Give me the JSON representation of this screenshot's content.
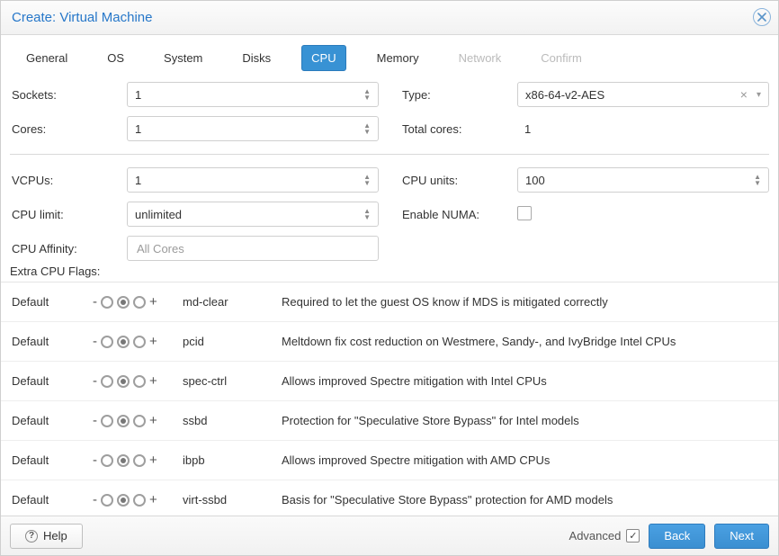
{
  "title": "Create: Virtual Machine",
  "tabs": [
    {
      "label": "General",
      "state": "normal"
    },
    {
      "label": "OS",
      "state": "normal"
    },
    {
      "label": "System",
      "state": "normal"
    },
    {
      "label": "Disks",
      "state": "normal"
    },
    {
      "label": "CPU",
      "state": "active"
    },
    {
      "label": "Memory",
      "state": "normal"
    },
    {
      "label": "Network",
      "state": "disabled"
    },
    {
      "label": "Confirm",
      "state": "disabled"
    }
  ],
  "form": {
    "sockets": {
      "label": "Sockets:",
      "value": "1"
    },
    "cores": {
      "label": "Cores:",
      "value": "1"
    },
    "type": {
      "label": "Type:",
      "value": "x86-64-v2-AES"
    },
    "total_cores": {
      "label": "Total cores:",
      "value": "1"
    },
    "vcpus": {
      "label": "VCPUs:",
      "value": "1"
    },
    "cpu_limit": {
      "label": "CPU limit:",
      "value": "unlimited"
    },
    "cpu_affinity": {
      "label": "CPU Affinity:",
      "placeholder": "All Cores"
    },
    "cpu_units": {
      "label": "CPU units:",
      "value": "100"
    },
    "enable_numa": {
      "label": "Enable NUMA:",
      "checked": false
    }
  },
  "flags_section_label": "Extra CPU Flags:",
  "flag_state_label": "Default",
  "flags": [
    {
      "name": "md-clear",
      "desc": "Required to let the guest OS know if MDS is mitigated correctly"
    },
    {
      "name": "pcid",
      "desc": "Meltdown fix cost reduction on Westmere, Sandy-, and IvyBridge Intel CPUs"
    },
    {
      "name": "spec-ctrl",
      "desc": "Allows improved Spectre mitigation with Intel CPUs"
    },
    {
      "name": "ssbd",
      "desc": "Protection for \"Speculative Store Bypass\" for Intel models"
    },
    {
      "name": "ibpb",
      "desc": "Allows improved Spectre mitigation with AMD CPUs"
    },
    {
      "name": "virt-ssbd",
      "desc": "Basis for \"Speculative Store Bypass\" protection for AMD models"
    }
  ],
  "footer": {
    "help": "Help",
    "advanced": "Advanced",
    "advanced_checked": true,
    "back": "Back",
    "next": "Next"
  }
}
